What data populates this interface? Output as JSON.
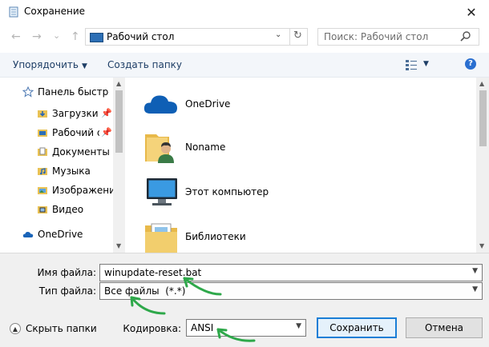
{
  "window": {
    "title": "Сохранение",
    "close_glyph": "✕"
  },
  "nav": {
    "back": "←",
    "forward": "→",
    "recent": "⌄",
    "up": "↑"
  },
  "address": {
    "path": "Рабочий стол",
    "dropdown": "⌄",
    "refresh": "↻"
  },
  "search": {
    "placeholder": "Поиск: Рабочий стол"
  },
  "toolbar": {
    "organize": "Упорядочить",
    "new_folder": "Создать папку",
    "arrow": "▼",
    "help": "?"
  },
  "navpane": {
    "quick_access": "Панель быстрого доступа",
    "items": [
      {
        "label": "Загрузки",
        "pinned": true
      },
      {
        "label": "Рабочий стол",
        "pinned": true
      },
      {
        "label": "Документы",
        "pinned": false
      },
      {
        "label": "Музыка",
        "pinned": false
      },
      {
        "label": "Изображения",
        "pinned": false
      },
      {
        "label": "Видео",
        "pinned": false
      }
    ],
    "onedrive": "OneDrive"
  },
  "content": {
    "items": [
      {
        "label": "OneDrive",
        "icon": "onedrive-icon"
      },
      {
        "label": "Noname",
        "icon": "user-folder-icon"
      },
      {
        "label": "Этот компьютер",
        "icon": "computer-icon"
      },
      {
        "label": "Библиотеки",
        "icon": "libraries-icon"
      }
    ]
  },
  "form": {
    "filename_label": "Имя файла:",
    "filename_value": "winupdate-reset.bat",
    "filetype_label": "Тип файла:",
    "filetype_value": "Все файлы  (*.*)",
    "encoding_label": "Кодировка:",
    "encoding_value": "ANSI",
    "hide_folders": "Скрыть папки",
    "save": "Сохранить",
    "cancel": "Отмена"
  },
  "colors": {
    "accent": "#1a7ed6",
    "annotation": "#2ea84a",
    "toolbar_text": "#1e3e66"
  }
}
